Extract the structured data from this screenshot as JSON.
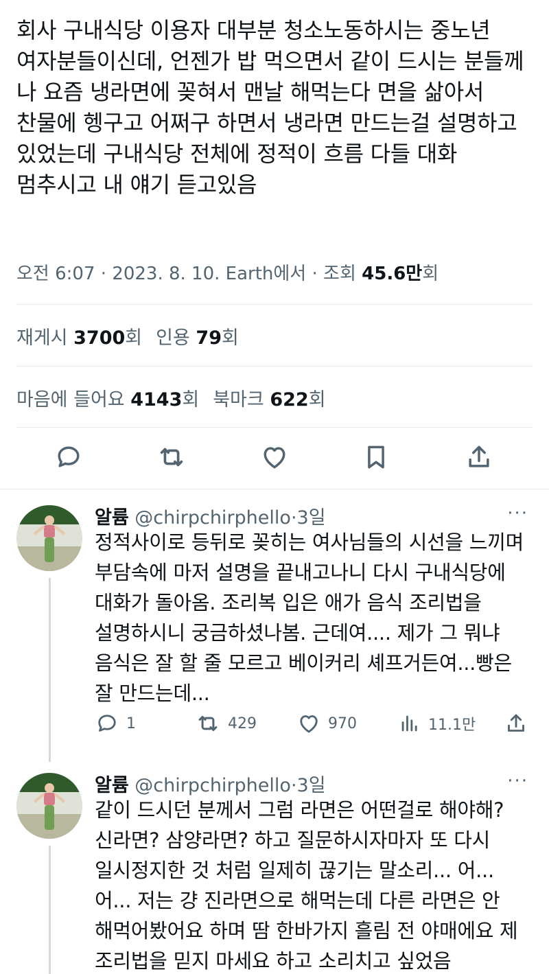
{
  "tweet": {
    "text": "회사 구내식당 이용자 대부분 청소노동하시는 중노년 여자분들이신데, 언젠가 밥 먹으면서 같이 드시는 분들께 나 요즘 냉라면에 꽂혀서 맨날 해먹는다 면을 삶아서 찬물에 헹구고 어쩌구 하면서 냉라면 만드는걸 설명하고 있었는데 구내식당 전체에 정적이 흐름 다들 대화 멈추시고 내 얘기 듣고있음",
    "meta_prefix": "오전 6:07 · 2023. 8. 10. Earth에서 · 조회 ",
    "views": "45.6만",
    "views_suffix": "회"
  },
  "stats": {
    "reposts_label": "재게시",
    "reposts": "3700",
    "reposts_suffix": "회",
    "quotes_label": "인용",
    "quotes": "79",
    "quotes_suffix": "회",
    "likes_label": "마음에 들어요",
    "likes": "4143",
    "likes_suffix": "회",
    "bookmarks_label": "북마크",
    "bookmarks": "622",
    "bookmarks_suffix": "회"
  },
  "actions": [
    "reply-icon",
    "repost-icon",
    "like-icon",
    "bookmark-icon",
    "share-icon"
  ],
  "replies": [
    {
      "name": "알륨",
      "handle": "@chirpchirphello",
      "dot": "·",
      "time": "3일",
      "more": "···",
      "text": "정적사이로 등뒤로 꽂히는 여사님들의 시선을 느끼며 부담속에 마저 설명을 끝내고나니 다시 구내식당에 대화가 돌아옴. 조리복 입은 애가 음식 조리법을 설명하시니 궁금하셨나봄. 근데여.... 제가 그 뭐냐 음식은 잘 할 줄 모르고 베이커리 셰프거든여...빵은 잘 만드는데...",
      "replies": "1",
      "reposts": "429",
      "likes": "970",
      "views": "11.1만"
    },
    {
      "name": "알륨",
      "handle": "@chirpchirphello",
      "dot": "·",
      "time": "3일",
      "more": "···",
      "text": "같이 드시던 분께서 그럼 라면은 어떤걸로 해야해? 신라면? 삼양라면? 하고 질문하시자마자 또 다시 일시정지한 것 처럼 일제히 끊기는 말소리... 어... 어... 저는 걍 진라면으로 해먹는데 다른 라면은 안 해먹어봤어요 하며 땀 한바가지 흘림 전 야매에요 제 조리법을 믿지 마세요 하고 소리치고 싶었음"
    }
  ],
  "colors": {
    "text": "#0f1419",
    "secondary": "#536471",
    "divider": "#e6e9eb",
    "thread_line": "#cfd9de"
  }
}
